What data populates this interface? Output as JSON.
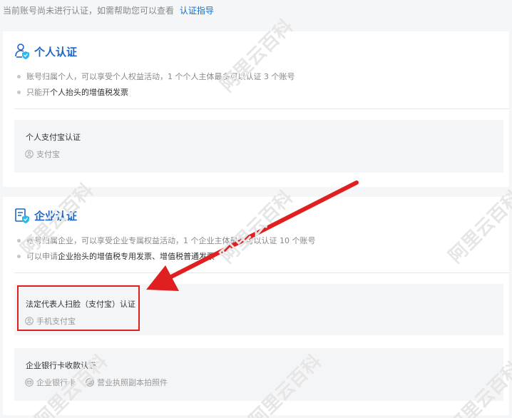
{
  "notice": {
    "text": "当前账号尚未进行认证，如需帮助您可以查看",
    "link": "认证指导"
  },
  "personal": {
    "title": "个人认证",
    "bullets": [
      "账号归属个人，可以享受个人权益活动，1 个个人主体最多可以认证 3 个账号",
      {
        "prefix": "只能开 ",
        "strong": "个人抬头的增值税发票"
      }
    ],
    "method": {
      "title": "个人支付宝认证",
      "options": [
        {
          "label": "支付宝",
          "icon": "alipay-icon"
        }
      ]
    }
  },
  "enterprise": {
    "title": "企业认证",
    "bullets": [
      "账号归属企业，可以享受企业专属权益活动，1 个企业主体最多可以认证 10 个账号",
      {
        "prefix": "可以申请 ",
        "strong": "企业抬头的增值税专用发票、增值税普通发票"
      }
    ],
    "methods": [
      {
        "title": "法定代表人扫脸（支付宝）认证",
        "options": [
          {
            "label": "手机支付宝",
            "icon": "alipay-icon"
          }
        ]
      },
      {
        "title": "企业银行卡收款认证",
        "options": [
          {
            "label": "企业银行卡",
            "icon": "bank-card-icon"
          },
          {
            "label": "营业执照副本拍照件",
            "icon": "camera-icon"
          }
        ]
      }
    ]
  },
  "watermark": "阿里云百科",
  "colors": {
    "accent": "#1f66c4",
    "link": "#0a6fd6",
    "annotation": "#e02020"
  }
}
